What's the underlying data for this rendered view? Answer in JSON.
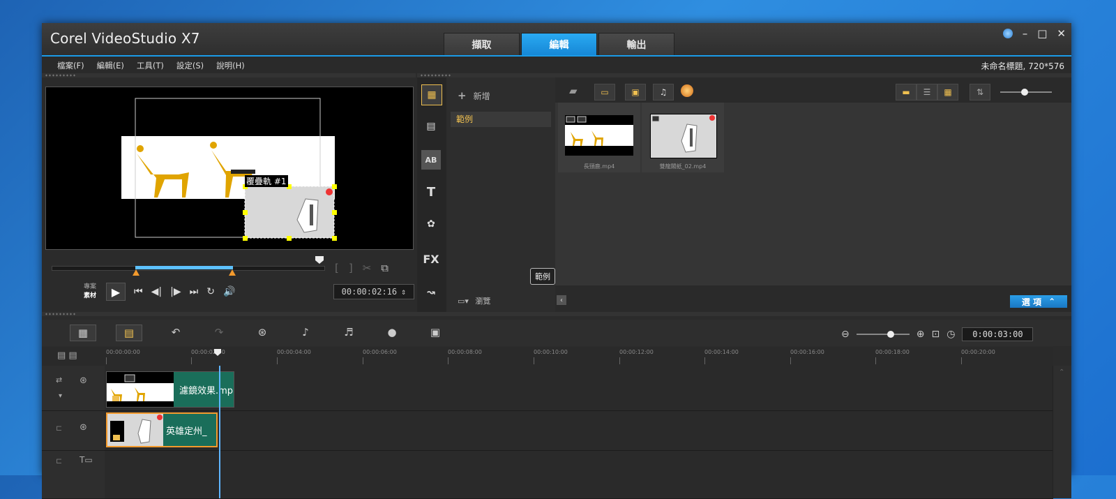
{
  "app": {
    "title": "Corel VideoStudio X7",
    "project_info": "未命名標題, 720*576",
    "mode_tabs": [
      "擷取",
      "編輯",
      "輸出"
    ],
    "active_tab": "編輯",
    "window_controls": [
      "globe-icon",
      "minimize-icon",
      "maximize-icon",
      "close-icon"
    ]
  },
  "menu": [
    "檔案(F)",
    "編輯(E)",
    "工具(T)",
    "設定(S)",
    "說明(H)"
  ],
  "preview": {
    "overlay_label": "覆疊軌 #1",
    "project_label": "專案",
    "clip_label": "素材",
    "timecode": "00:00:02:16",
    "mark_buttons": [
      "mark-in-icon",
      "mark-out-icon",
      "split-icon",
      "enlarge-icon"
    ],
    "transport_buttons": [
      "play-icon",
      "home-icon",
      "previous-frame-icon",
      "next-frame-icon",
      "end-icon",
      "repeat-icon",
      "volume-icon"
    ]
  },
  "library": {
    "add_label": "新增",
    "selected_folder": "範例",
    "tooltip": "範例",
    "browse_label": "瀏覽",
    "options_label": "選 項",
    "category_icons": [
      "media-icon",
      "instant-project-icon",
      "transition-icon",
      "title-icon",
      "graphic-icon",
      "filter-icon",
      "path-icon"
    ],
    "thumbnails": [
      {
        "name": "長頸鹿.mp4"
      },
      {
        "name": "雙龍閣紙_02.mp4"
      }
    ]
  },
  "timeline": {
    "duration": "0:00:03:00",
    "ruler_ticks": [
      "00:00:00:00",
      "00:00:02:00",
      "00:00:04:00",
      "00:00:06:00",
      "00:00:08:00",
      "00:00:10:00",
      "00:00:12:00",
      "00:00:14:00",
      "00:00:16:00",
      "00:00:18:00",
      "00:00:20:00"
    ],
    "tracks": [
      {
        "type": "video",
        "clip_label": "濾鏡效果.mp"
      },
      {
        "type": "overlay",
        "clip_label": "英雄定州_"
      },
      {
        "type": "title",
        "clip_label": ""
      }
    ]
  }
}
